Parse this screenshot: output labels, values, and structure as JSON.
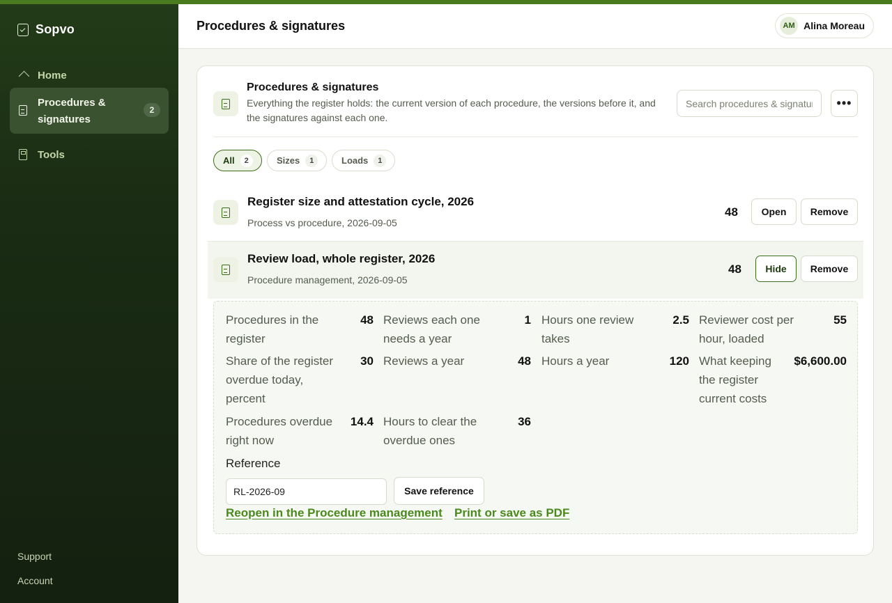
{
  "app": {
    "name": "Sopvo"
  },
  "sidebar": {
    "items": [
      {
        "label": "Home",
        "icon": "home-icon"
      },
      {
        "label": "Procedures & signatures",
        "icon": "document-icon",
        "badge": "2",
        "active": true
      },
      {
        "label": "Tools",
        "icon": "calculator-icon"
      }
    ],
    "footer": {
      "support": "Support",
      "account": "Account"
    }
  },
  "header": {
    "title": "Procedures & signatures",
    "user": {
      "initials": "AM",
      "name": "Alina Moreau"
    }
  },
  "card": {
    "title": "Procedures & signatures",
    "description": "Everything the register holds: the current version of each procedure, the versions before it, and the signatures against each one.",
    "search_placeholder": "Search procedures & signatures",
    "more_label": "•••"
  },
  "filters": [
    {
      "label": "All",
      "count": "2",
      "active": true
    },
    {
      "label": "Sizes",
      "count": "1"
    },
    {
      "label": "Loads",
      "count": "1"
    }
  ],
  "records": [
    {
      "title": "Register size and attestation cycle, 2026",
      "subtitle": "Process vs procedure, 2026-09-05",
      "value": "48",
      "primary_action": "Open",
      "remove_label": "Remove"
    },
    {
      "title": "Review load, whole register, 2026",
      "subtitle": "Procedure management, 2026-09-05",
      "value": "48",
      "primary_action": "Hide",
      "remove_label": "Remove",
      "expanded": true
    }
  ],
  "detail": {
    "metrics": [
      {
        "label": "Procedures in the register",
        "value": "48"
      },
      {
        "label": "Reviews each one needs a year",
        "value": "1"
      },
      {
        "label": "Hours one review takes",
        "value": "2.5"
      },
      {
        "label": "Reviewer cost per hour, loaded",
        "value": "55"
      },
      {
        "label": "Share of the register overdue today, percent",
        "value": "30"
      },
      {
        "label": "Reviews a year",
        "value": "48"
      },
      {
        "label": "Hours a year",
        "value": "120"
      },
      {
        "label": "What keeping the register current costs",
        "value": "$6,600.00"
      },
      {
        "label": "Procedures overdue right now",
        "value": "14.4"
      },
      {
        "label": "Hours to clear the overdue ones",
        "value": "36"
      }
    ],
    "reference_label": "Reference",
    "reference_value": "RL-2026-09",
    "save_label": "Save reference",
    "links": {
      "reopen": "Reopen in the Procedure management",
      "print": "Print or save as PDF"
    }
  },
  "colors": {
    "accent": "#4a7a1e",
    "sidebar_bg": "#1a2c14",
    "link": "#4a8a1c"
  }
}
